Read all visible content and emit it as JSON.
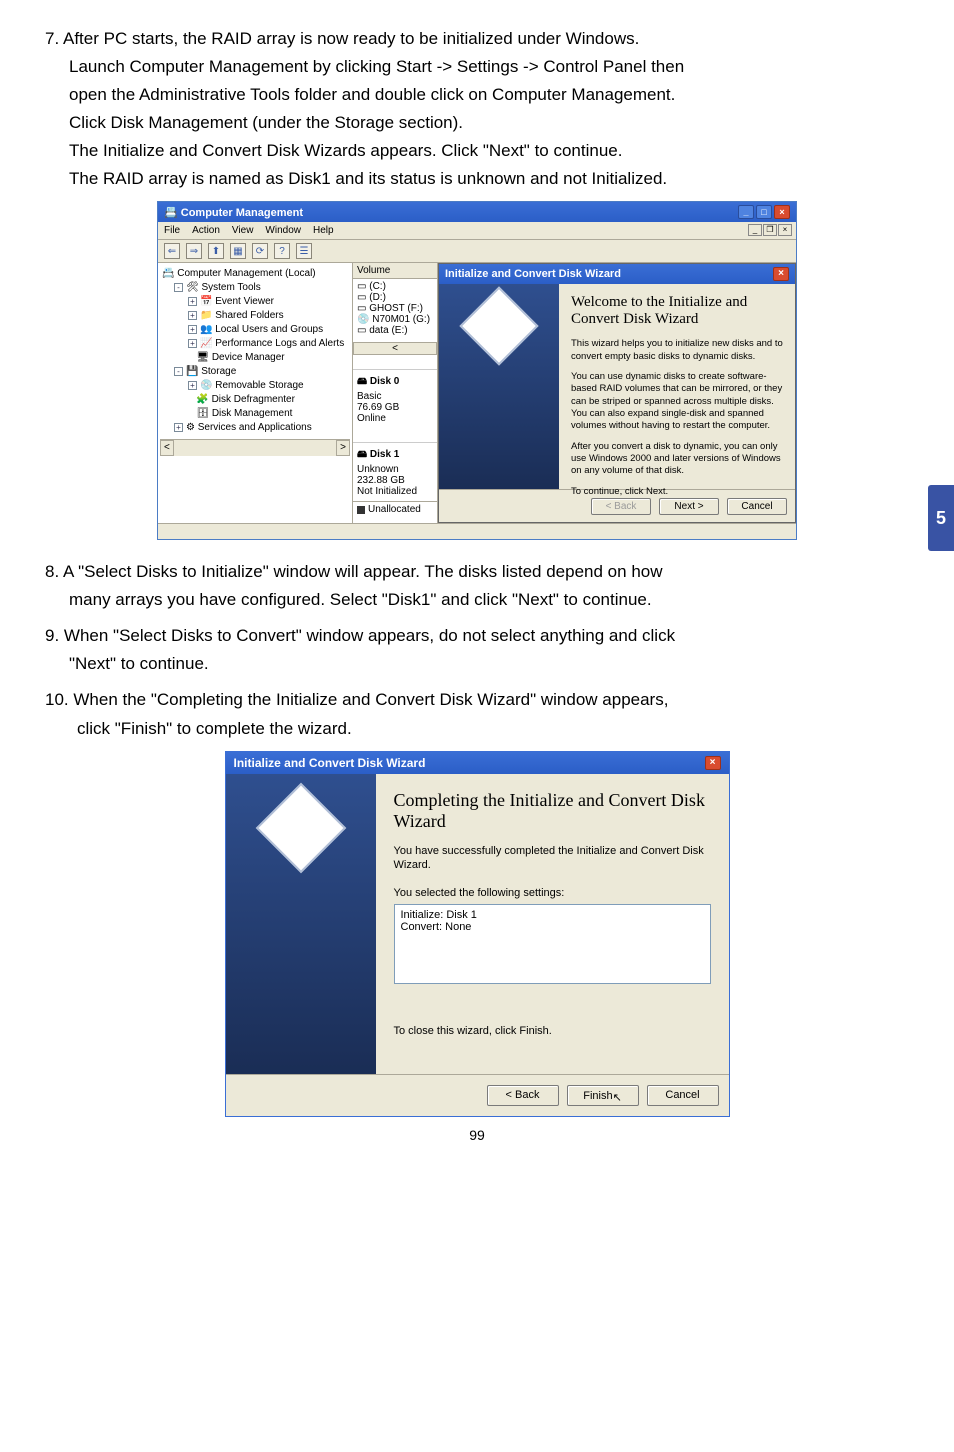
{
  "steps": {
    "s7": {
      "num": "7.",
      "l1": "After PC starts, the RAID array is now ready to be initialized under Windows.",
      "l2": "Launch Computer Management by clicking Start -> Settings -> Control Panel then",
      "l3": "open the Administrative Tools folder and double click on Computer Management.",
      "l4": "Click Disk Management (under the Storage section).",
      "l5": "The Initialize and Convert Disk Wizards appears. Click \"Next\" to continue.",
      "l6": "The RAID array is named as Disk1 and its status is unknown and not Initialized."
    },
    "s8": {
      "num": "8.",
      "l1": "A \"Select Disks to Initialize\" window will appear. The disks listed depend on how",
      "l2": "many arrays you have configured. Select \"Disk1\" and click \"Next\" to continue."
    },
    "s9": {
      "num": "9.",
      "l1": "When \"Select Disks to Convert\" window appears, do not select anything and click",
      "l2": "\"Next\" to continue."
    },
    "s10": {
      "num": "10.",
      "l1": "When the \"Completing the Initialize and Convert Disk Wizard\" window appears,",
      "l2": "click \"Finish\" to complete the wizard."
    }
  },
  "cm": {
    "title": "Computer Management",
    "menu": {
      "file": "File",
      "action": "Action",
      "view": "View",
      "window": "Window",
      "help": "Help"
    },
    "tree": {
      "root": "Computer Management (Local)",
      "system_tools": "System Tools",
      "event_viewer": "Event Viewer",
      "shared_folders": "Shared Folders",
      "local_users": "Local Users and Groups",
      "perf_logs": "Performance Logs and Alerts",
      "device_mgr": "Device Manager",
      "storage": "Storage",
      "removable": "Removable Storage",
      "defrag": "Disk Defragmenter",
      "diskmgmt": "Disk Management",
      "services": "Services and Applications"
    },
    "vol": {
      "hdr": "Volume",
      "c": "(C:)",
      "d": "(D:)",
      "f": "GHOST (F:)",
      "g": "N70M01 (G:)",
      "e": "data (E:)",
      "disk0": {
        "name": "Disk 0",
        "type": "Basic",
        "size": "76.69 GB",
        "status": "Online"
      },
      "disk1": {
        "name": "Disk 1",
        "type": "Unknown",
        "size": "232.88 GB",
        "status": "Not Initialized"
      },
      "legend": "Unallocated"
    }
  },
  "wizard1": {
    "title": "Initialize and Convert Disk Wizard",
    "heading": "Welcome to the Initialize and Convert Disk Wizard",
    "p1": "This wizard helps you to initialize new disks and to convert empty basic disks to dynamic disks.",
    "p2": "You can use dynamic disks to create software-based RAID volumes that can be mirrored, or they can be striped or spanned across multiple disks. You can also expand single-disk and spanned volumes without having to restart the computer.",
    "p3": "After you convert a disk to dynamic, you can only use Windows 2000 and later versions of Windows on any volume of that disk.",
    "p4": "To continue, click Next.",
    "back": "< Back",
    "next": "Next >",
    "cancel": "Cancel"
  },
  "wizard2": {
    "title": "Initialize and Convert Disk Wizard",
    "heading": "Completing the Initialize and Convert Disk Wizard",
    "p1": "You have successfully completed the Initialize and Convert Disk Wizard.",
    "p2": "You selected the following settings:",
    "set1": "Initialize: Disk 1",
    "set2": "Convert: None",
    "p3": "To close this wizard, click Finish.",
    "back": "< Back",
    "finish": "Finish",
    "cancel": "Cancel"
  },
  "side_tab": "5",
  "page_number": "99"
}
